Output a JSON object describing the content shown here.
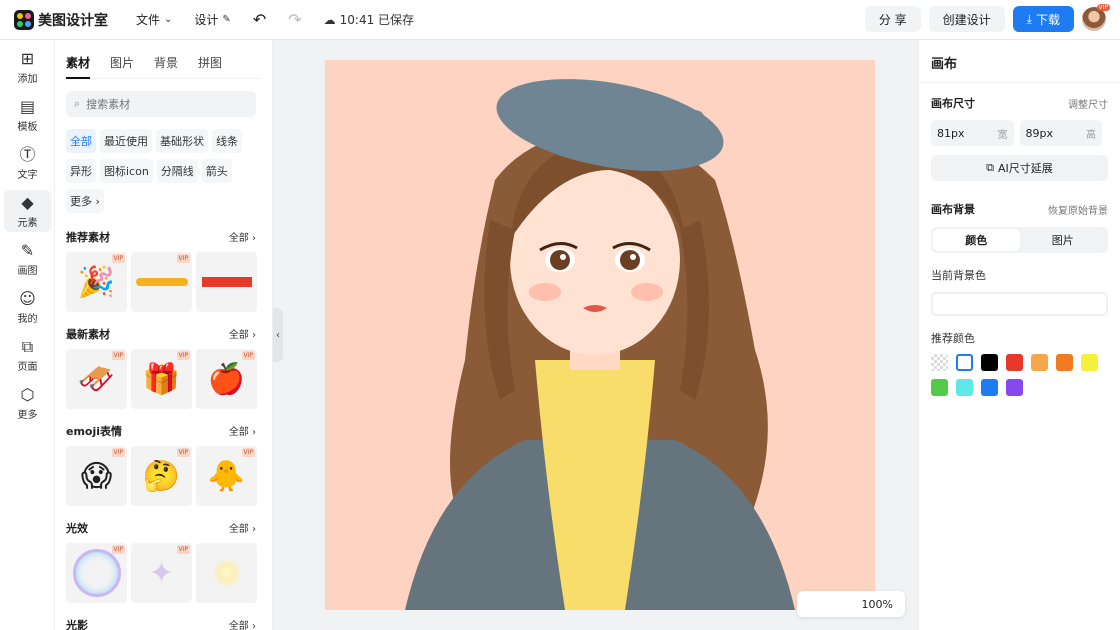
{
  "app": {
    "name": "美图设计室"
  },
  "topbar": {
    "menu_file": "文件",
    "menu_design": "设计",
    "saved_status": "10:41 已保存",
    "share": "分 享",
    "create": "创建设计",
    "download": "下载",
    "avatar_badge": "VIP"
  },
  "rail": [
    {
      "label": "添加",
      "icon": "plus-square-icon"
    },
    {
      "label": "模板",
      "icon": "template-icon"
    },
    {
      "label": "文字",
      "icon": "text-icon"
    },
    {
      "label": "元素",
      "icon": "shapes-icon"
    },
    {
      "label": "画图",
      "icon": "draw-icon"
    },
    {
      "label": "我的",
      "icon": "user-icon"
    },
    {
      "label": "页面",
      "icon": "page-add-icon"
    },
    {
      "label": "更多",
      "icon": "cube-icon"
    }
  ],
  "panel": {
    "tabs": [
      "素材",
      "图片",
      "背景",
      "拼图"
    ],
    "search_placeholder": "搜索素材",
    "chips": [
      "全部",
      "最近使用",
      "基础形状",
      "线条",
      "异形",
      "图标icon",
      "分隔线",
      "箭头",
      "更多"
    ],
    "all_label": "全部",
    "vip": "VIP",
    "sections": [
      {
        "title": "推荐素材"
      },
      {
        "title": "最新素材"
      },
      {
        "title": "emoji表情"
      },
      {
        "title": "光效"
      },
      {
        "title": "光影"
      }
    ]
  },
  "canvas": {
    "zoom": "100%",
    "background": "#ffd3c2"
  },
  "right": {
    "title": "画布",
    "size_title": "画布尺寸",
    "size_link": "调整尺寸",
    "width_value": "81px",
    "width_unit": "宽",
    "height_value": "89px",
    "height_unit": "高",
    "ai_button": "AI尺寸延展",
    "bg_title": "画布背景",
    "bg_link": "恢复原始背景",
    "seg_color": "颜色",
    "seg_image": "图片",
    "current_bg": "当前背景色",
    "recommended": "推荐颜色",
    "swatches": [
      "transparent",
      "#ffffff",
      "#000000",
      "#e8382a",
      "#f5a84a",
      "#f07a22",
      "#f5ef3e",
      "#55c94a",
      "#5ee8e8",
      "#1e7cf2",
      "#8848f0"
    ]
  },
  "colors": {
    "accent": "#1e7cf2"
  }
}
